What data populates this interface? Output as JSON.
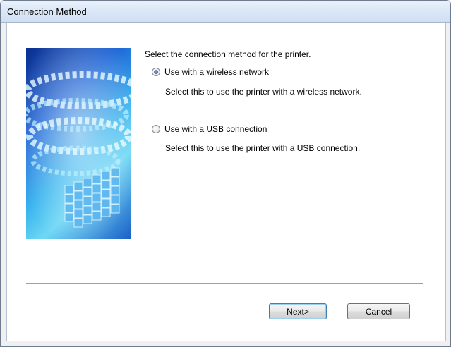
{
  "window": {
    "title": "Connection Method"
  },
  "main": {
    "prompt": "Select the connection method for the printer.",
    "options": [
      {
        "label": "Use with a wireless network",
        "description": "Select this to use the printer with a wireless network.",
        "selected": true
      },
      {
        "label": "Use with a USB connection",
        "description": "Select this to use the printer with a USB connection.",
        "selected": false
      }
    ]
  },
  "buttons": {
    "next": "Next>",
    "cancel": "Cancel"
  }
}
